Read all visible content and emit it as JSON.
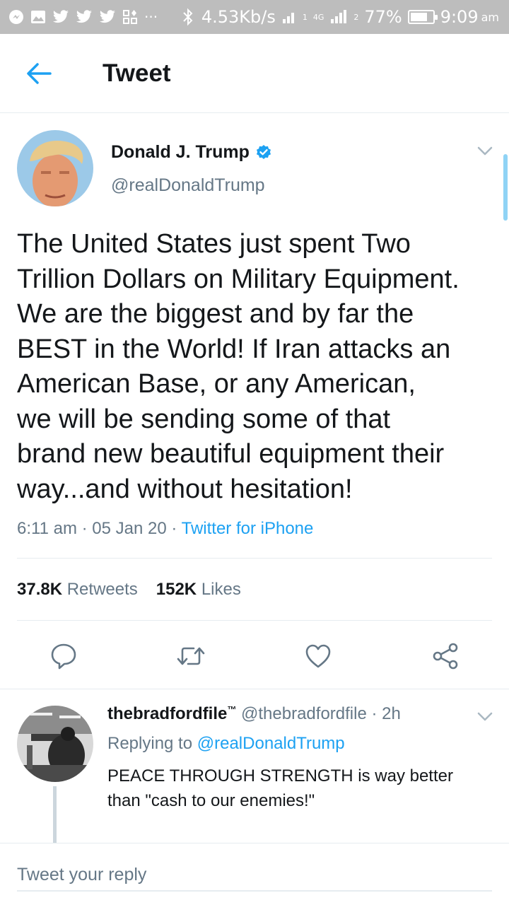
{
  "status_bar": {
    "network_speed": "4.53Kb/s",
    "net_type": "4G",
    "sim1": "1",
    "sim2": "2",
    "battery_percent": "77%",
    "battery_level": 0.77,
    "time": "9:09",
    "ampm": "am",
    "overflow": "···"
  },
  "header": {
    "title": "Tweet"
  },
  "tweet": {
    "author_name": "Donald J. Trump",
    "author_handle": "@realDonaldTrump",
    "text": "The United States just spent Two\nTrillion Dollars on Military Equipment.\nWe are the biggest and by far the\nBEST in the World! If Iran attacks an\nAmerican Base, or any American,\nwe will be sending some of that\nbrand new beautiful equipment their\nway...and without hesitation!",
    "time": "6:11 am",
    "date": "05 Jan 20",
    "source": "Twitter for iPhone",
    "sep": "·",
    "retweets_count": "37.8K",
    "retweets_label": "Retweets",
    "likes_count": "152K",
    "likes_label": "Likes"
  },
  "reply": {
    "name": "thebradfordfile",
    "tm": "™",
    "handle": "@thebradfordfile",
    "age": "2h",
    "sep": "·",
    "replying_prefix": "Replying to",
    "replying_to": "@realDonaldTrump",
    "text": "PEACE THROUGH STRENGTH is way better than \"cash to our enemies!\""
  },
  "compose": {
    "placeholder": "Tweet your reply"
  },
  "colors": {
    "accent": "#1da1f2",
    "secondary_text": "#657786",
    "status_bar": "#bdbdbd"
  }
}
